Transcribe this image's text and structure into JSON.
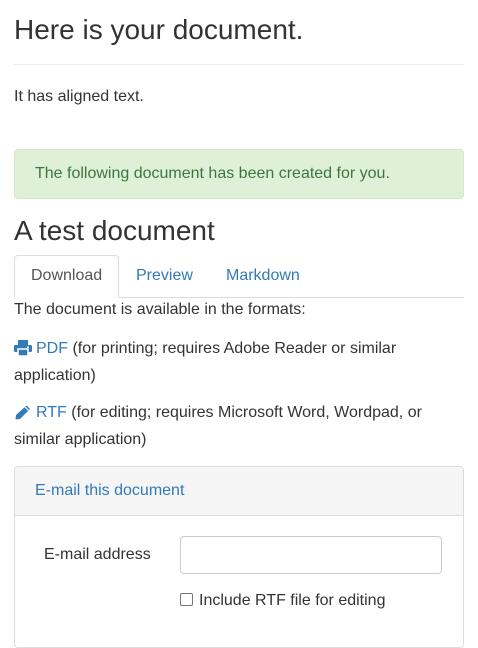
{
  "page": {
    "heading": "Here is your document.",
    "intro": "It has aligned text."
  },
  "alert": {
    "text": "The following document has been created for you."
  },
  "document": {
    "title": "A test document"
  },
  "tabs": [
    {
      "label": "Download",
      "active": true
    },
    {
      "label": "Preview",
      "active": false
    },
    {
      "label": "Markdown",
      "active": false
    }
  ],
  "download": {
    "available_text": "The document is available in the formats:",
    "formats": [
      {
        "icon": "printer-icon",
        "label": "PDF",
        "description": "(for printing; requires Adobe Reader or similar application)"
      },
      {
        "icon": "pencil-icon",
        "label": "RTF",
        "description": "(for editing; requires Microsoft Word, Wordpad, or similar application)"
      }
    ]
  },
  "email_panel": {
    "heading": "E-mail this document",
    "email_label": "E-mail address",
    "email_value": "",
    "include_rtf_label": "Include RTF file for editing",
    "include_rtf_checked": false
  },
  "colors": {
    "link": "#337ab7",
    "alert_bg": "#dff0d8",
    "alert_text": "#3c763d"
  }
}
